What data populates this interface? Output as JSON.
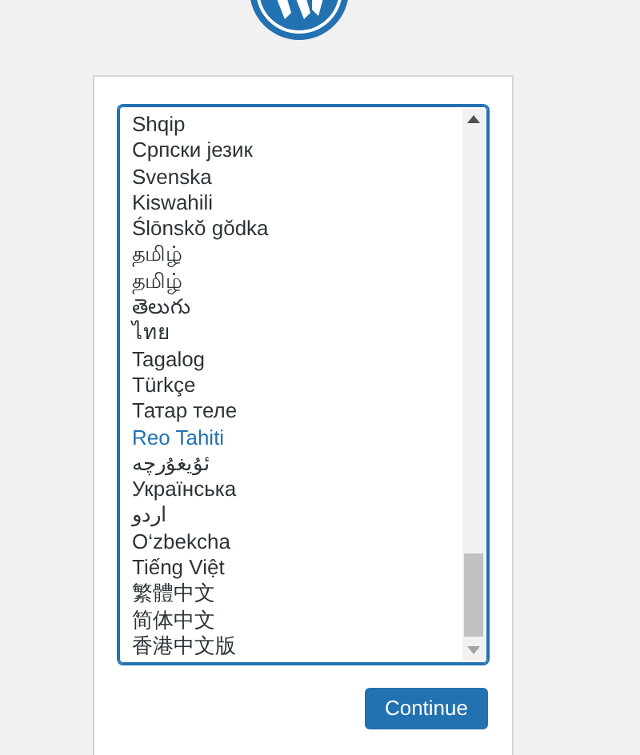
{
  "language_list": {
    "options": [
      {
        "label": "Shqip",
        "selected": false
      },
      {
        "label": "Српски језик",
        "selected": false
      },
      {
        "label": "Svenska",
        "selected": false
      },
      {
        "label": "Kiswahili",
        "selected": false
      },
      {
        "label": "Ślōnskŏ gŏdka",
        "selected": false
      },
      {
        "label": "தமிழ்",
        "selected": false
      },
      {
        "label": "தமிழ்",
        "selected": false
      },
      {
        "label": "తెలుగు",
        "selected": false
      },
      {
        "label": "ไทย",
        "selected": false
      },
      {
        "label": "Tagalog",
        "selected": false
      },
      {
        "label": "Türkçe",
        "selected": false
      },
      {
        "label": "Татар теле",
        "selected": false
      },
      {
        "label": "Reo Tahiti",
        "selected": true
      },
      {
        "label": "ئۇيغۇرچە",
        "selected": false
      },
      {
        "label": "Українська",
        "selected": false
      },
      {
        "label": "اردو",
        "selected": false
      },
      {
        "label": "O‘zbekcha",
        "selected": false
      },
      {
        "label": "Tiếng Việt",
        "selected": false
      },
      {
        "label": "繁體中文",
        "selected": false
      },
      {
        "label": "简体中文",
        "selected": false
      },
      {
        "label": "香港中文版",
        "selected": false
      }
    ]
  },
  "continue_button": {
    "label": "Continue"
  }
}
